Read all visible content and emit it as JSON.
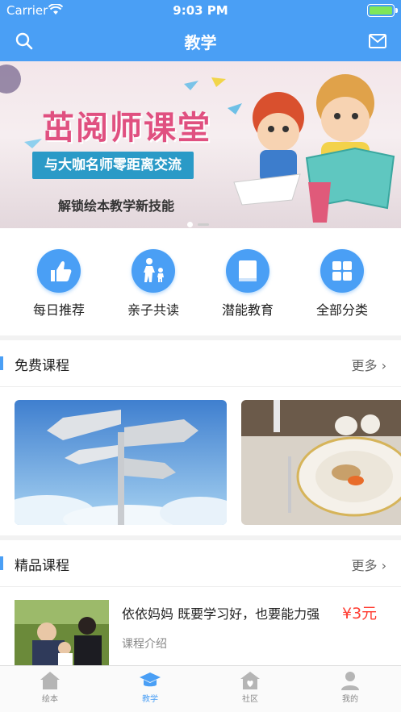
{
  "status": {
    "carrier": "Carrier",
    "time": "9:03 PM"
  },
  "nav": {
    "title": "教学"
  },
  "banner": {
    "title": "茁阅师课堂",
    "ribbon": "与大咖名师零距离交流",
    "subtitle": "解锁绘本教学新技能"
  },
  "categories": [
    {
      "label": "每日推荐",
      "icon": "thumbs-up-icon"
    },
    {
      "label": "亲子共读",
      "icon": "parent-child-icon"
    },
    {
      "label": "潜能教育",
      "icon": "book-icon"
    },
    {
      "label": "全部分类",
      "icon": "grid-icon"
    }
  ],
  "free": {
    "title": "免费课程",
    "more": "更多"
  },
  "premium": {
    "title": "精品课程",
    "more": "更多",
    "item": {
      "title": "依依妈妈 既要学习好，也要能力强",
      "price": "¥3元",
      "desc": "课程介绍"
    }
  },
  "tabs": [
    {
      "label": "绘本",
      "icon": "home-icon"
    },
    {
      "label": "教学",
      "icon": "graduation-cap-icon"
    },
    {
      "label": "社区",
      "icon": "community-icon"
    },
    {
      "label": "我的",
      "icon": "user-icon"
    }
  ],
  "colors": {
    "accent": "#4a9ff5",
    "price": "#ff3b30"
  }
}
